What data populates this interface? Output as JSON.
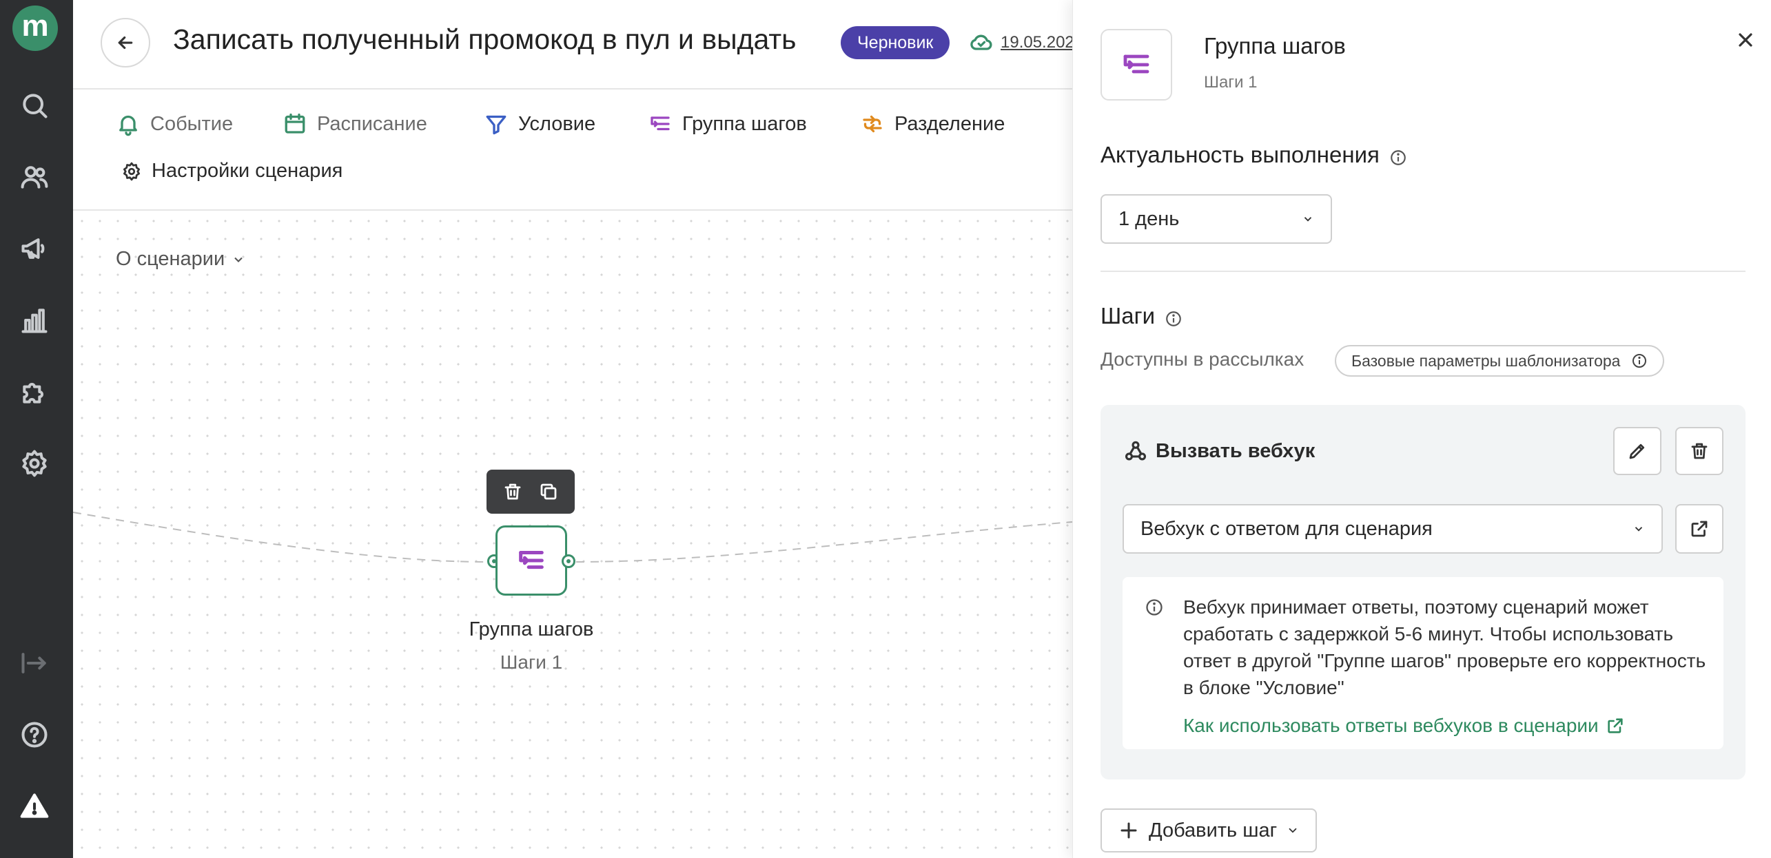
{
  "app": {
    "logo_letter": "m",
    "colors": {
      "brand": "#3a8f6a",
      "draft_badge": "#4b40a8",
      "step_icon": "#9b46c0",
      "link": "#2e8a5f",
      "rail": "#2d2f31"
    }
  },
  "rail": {
    "items": [
      {
        "icon": "search-icon"
      },
      {
        "icon": "users-icon"
      },
      {
        "icon": "megaphone-icon"
      },
      {
        "icon": "bar-chart-icon"
      },
      {
        "icon": "puzzle-icon"
      },
      {
        "icon": "gear-icon"
      },
      {
        "icon": "collapse-arrow-icon"
      },
      {
        "icon": "help-icon"
      },
      {
        "icon": "warning-icon"
      }
    ]
  },
  "header": {
    "title": "Записать полученный промокод в пул и выдать",
    "status_badge": "Черновик",
    "saved_date": "19.05.202"
  },
  "toolbar": {
    "items": [
      {
        "label": "Событие",
        "icon": "bell-icon"
      },
      {
        "label": "Расписание",
        "icon": "calendar-icon"
      },
      {
        "label": "Условие",
        "icon": "filter-icon"
      },
      {
        "label": "Группа шагов",
        "icon": "step-group-icon"
      },
      {
        "label": "Разделение",
        "icon": "split-icon"
      }
    ],
    "settings_label": "Настройки сценария"
  },
  "canvas": {
    "about_label": "О сценарии",
    "node": {
      "title": "Группа шагов",
      "subtitle": "Шаги 1"
    }
  },
  "panel": {
    "title": "Группа шагов",
    "subtitle": "Шаги 1",
    "relevance": {
      "label": "Актуальность выполнения",
      "value": "1 день"
    },
    "steps": {
      "label": "Шаги",
      "available_label": "Доступны в рассылках",
      "chip_label": "Базовые параметры шаблонизатора",
      "step": {
        "title": "Вызвать вебхук",
        "webhook_value": "Вебхук с ответом для сценария",
        "note_text": "Вебхук принимает ответы, поэтому сценарий может сработать с задержкой 5-6 минут. Чтобы использовать ответ в другой \"Группе шагов\" проверьте его корректность в блоке \"Условие\"",
        "note_link": "Как использовать ответы вебхуков в сценарии"
      },
      "add_label": "Добавить шаг"
    }
  }
}
